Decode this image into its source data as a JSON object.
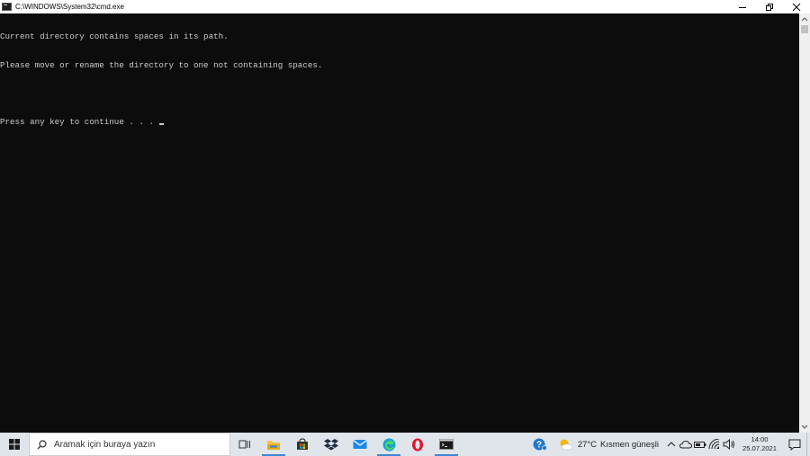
{
  "window": {
    "title": "C:\\WINDOWS\\System32\\cmd.exe",
    "controls": [
      "minimize",
      "restore",
      "close"
    ]
  },
  "console": {
    "lines": [
      "Current directory contains spaces in its path.",
      "Please move or rename the directory to one not containing spaces.",
      "",
      "Press any key to continue . . ."
    ],
    "background": "#0c0c0c",
    "foreground": "#cccccc"
  },
  "taskbar": {
    "search_placeholder": "Aramak için buraya yazın",
    "pinned": [
      {
        "name": "task-view-icon"
      },
      {
        "name": "file-explorer-icon"
      },
      {
        "name": "store-icon"
      },
      {
        "name": "dropbox-icon"
      },
      {
        "name": "mail-icon"
      },
      {
        "name": "edge-icon"
      },
      {
        "name": "opera-icon"
      },
      {
        "name": "cmd-icon"
      }
    ],
    "weather": {
      "temperature": "27°C",
      "condition": "Kısmen güneşli"
    },
    "clock": {
      "time": "14:00",
      "date": "25.07.2021"
    },
    "accent": "#3b87d3"
  }
}
